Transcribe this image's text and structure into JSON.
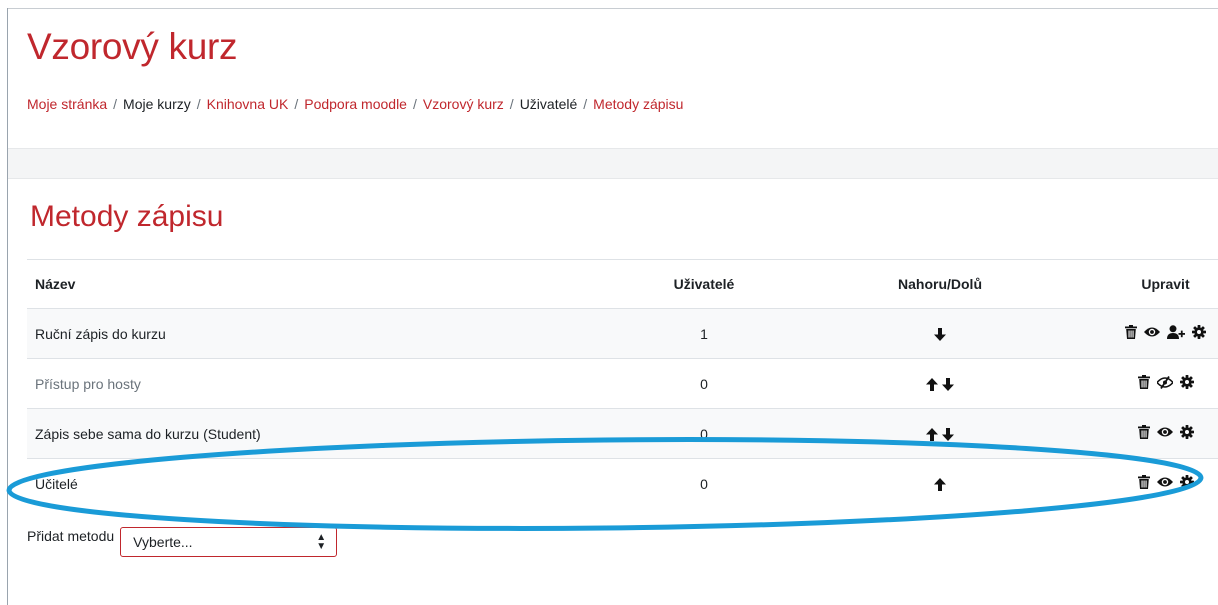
{
  "page": {
    "title": "Vzorový kurz",
    "breadcrumb": [
      {
        "label": "Moje stránka",
        "link": true
      },
      {
        "label": "Moje kurzy",
        "link": false
      },
      {
        "label": "Knihovna UK",
        "link": true
      },
      {
        "label": "Podpora moodle",
        "link": true
      },
      {
        "label": "Vzorový kurz",
        "link": true
      },
      {
        "label": "Uživatelé",
        "link": false
      },
      {
        "label": "Metody zápisu",
        "link": true
      }
    ],
    "separator": "/"
  },
  "section": {
    "title": "Metody zápisu"
  },
  "table": {
    "headers": {
      "name": "Název",
      "users": "Uživatelé",
      "move": "Nahoru/Dolů",
      "edit": "Upravit"
    },
    "rows": [
      {
        "name": "Ruční zápis do kurzu",
        "users": "1",
        "move": [
          "down"
        ],
        "edit": [
          "trash-icon",
          "eye-icon",
          "add-user-icon",
          "gear-icon"
        ],
        "dimmed": false
      },
      {
        "name": "Přístup pro hosty",
        "users": "0",
        "move": [
          "up",
          "down"
        ],
        "edit": [
          "trash-icon",
          "eye-slash-icon",
          "gear-icon"
        ],
        "dimmed": true
      },
      {
        "name": "Zápis sebe sama do kurzu (Student)",
        "users": "0",
        "move": [
          "up",
          "down"
        ],
        "edit": [
          "trash-icon",
          "eye-icon",
          "gear-icon"
        ],
        "dimmed": false
      },
      {
        "name": "Učitelé",
        "users": "0",
        "move": [
          "up"
        ],
        "edit": [
          "trash-icon",
          "eye-icon",
          "gear-icon"
        ],
        "dimmed": false
      }
    ]
  },
  "add_method": {
    "label": "Přidat metodu",
    "selected": "Vyberte..."
  },
  "colors": {
    "accent": "#c0272d",
    "annotation": "#1a9bd7"
  }
}
